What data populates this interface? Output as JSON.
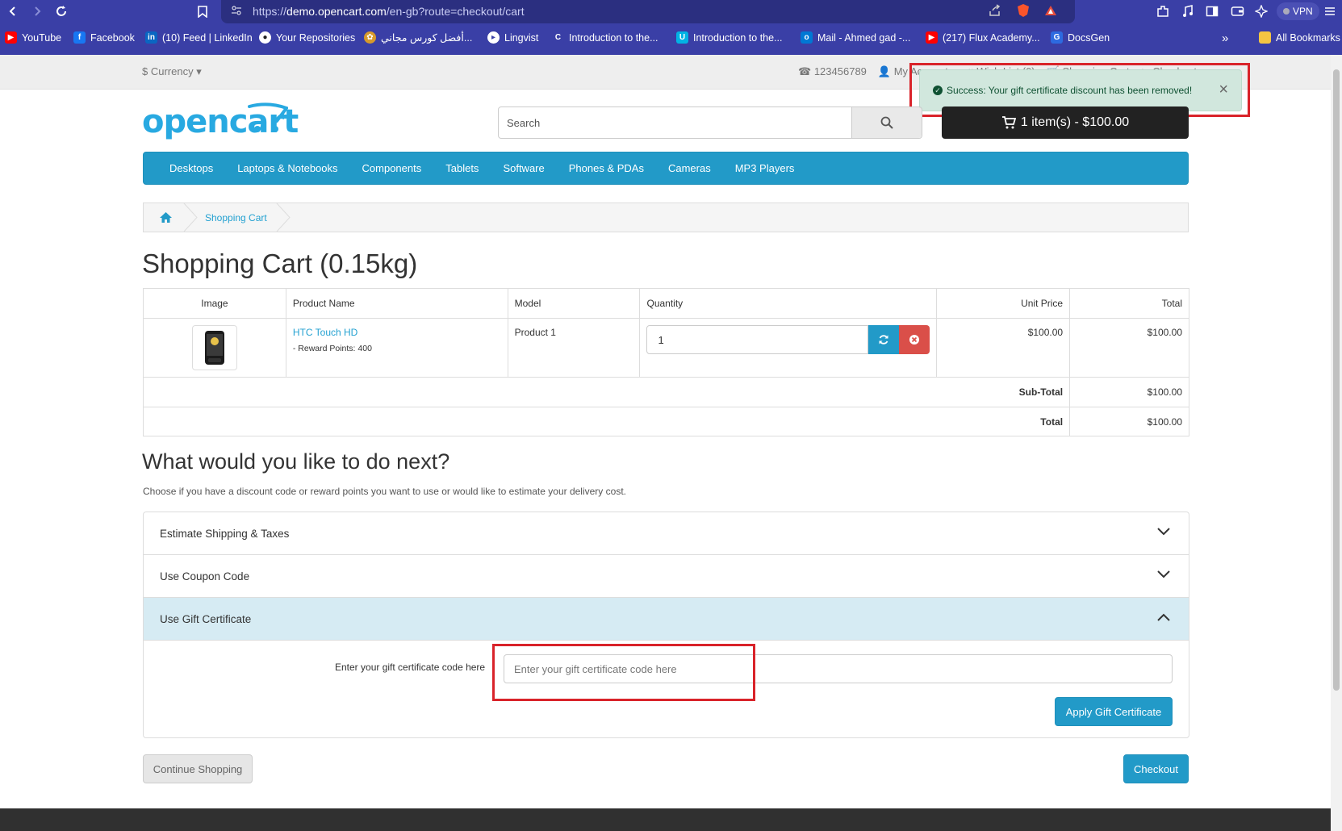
{
  "browser": {
    "url_prefix": "https://",
    "url_domain": "demo.opencart.com",
    "url_path": "/en-gb?route=checkout/cart",
    "vpn_label": "VPN",
    "bookmarks": [
      {
        "label": "YouTube",
        "icon": "youtube-icon",
        "color": "#ff0000"
      },
      {
        "label": "Facebook",
        "icon": "facebook-icon",
        "color": "#1877f2"
      },
      {
        "label": "(10) Feed | LinkedIn",
        "icon": "linkedin-icon",
        "color": "#0a66c2"
      },
      {
        "label": "Your Repositories",
        "icon": "github-icon",
        "color": "#222222"
      },
      {
        "label": "أفضل كورس مجاني...",
        "icon": "course-icon",
        "color": "#d79a2b"
      },
      {
        "label": "Lingvist",
        "icon": "lingvist-icon",
        "color": "#ffffff"
      },
      {
        "label": "Introduction to the...",
        "icon": "coursera-icon",
        "color": "#0056d2"
      },
      {
        "label": "Introduction to the...",
        "icon": "udacity-icon",
        "color": "#02b3e4"
      },
      {
        "label": "Mail - Ahmed gad -...",
        "icon": "outlook-icon",
        "color": "#0078d4"
      },
      {
        "label": "(217) Flux Academy...",
        "icon": "youtube-icon",
        "color": "#ff0000"
      },
      {
        "label": "DocsGen",
        "icon": "docsgen-icon",
        "color": "#2d6ae0"
      }
    ],
    "all_bookmarks": "All Bookmarks",
    "more": "»"
  },
  "topbar": {
    "currency": "$ Currency ▾",
    "phone": "123456789",
    "my_account": "My Account ▾",
    "wishlist": "Wish List (0)",
    "shopping_cart": "Shopping Cart",
    "checkout": "Checkout"
  },
  "alert": {
    "text": "Success: Your gift certificate discount has been removed!",
    "close": "×"
  },
  "header": {
    "logo": "opencart",
    "search_placeholder": "Search",
    "cart_button": "1 item(s) - $100.00"
  },
  "menu": [
    "Desktops",
    "Laptops & Notebooks",
    "Components",
    "Tablets",
    "Software",
    "Phones & PDAs",
    "Cameras",
    "MP3 Players"
  ],
  "breadcrumb": {
    "current": "Shopping Cart"
  },
  "page_title": "Shopping Cart (0.15kg)",
  "cart_table": {
    "headers": {
      "image": "Image",
      "name": "Product Name",
      "model": "Model",
      "quantity": "Quantity",
      "unit_price": "Unit Price",
      "total": "Total"
    },
    "rows": [
      {
        "name": "HTC Touch HD",
        "reward": "- Reward Points: 400",
        "model": "Product 1",
        "quantity": "1",
        "unit_price": "$100.00",
        "total": "$100.00"
      }
    ],
    "totals": [
      {
        "label": "Sub-Total",
        "value": "$100.00"
      },
      {
        "label": "Total",
        "value": "$100.00"
      }
    ]
  },
  "next": {
    "heading": "What would you like to do next?",
    "description": "Choose if you have a discount code or reward points you want to use or would like to estimate your delivery cost."
  },
  "accordion": {
    "shipping": "Estimate Shipping & Taxes",
    "coupon": "Use Coupon Code",
    "gift": "Use Gift Certificate",
    "gift_label": "Enter your gift certificate code here",
    "gift_placeholder": "Enter your gift certificate code here",
    "apply_button": "Apply Gift Certificate"
  },
  "buttons": {
    "continue": "Continue Shopping",
    "checkout": "Checkout"
  },
  "colors": {
    "accent": "#229ac8",
    "danger": "#da4f49",
    "highlight": "#d9232a",
    "success_bg": "#d1e7dd"
  }
}
